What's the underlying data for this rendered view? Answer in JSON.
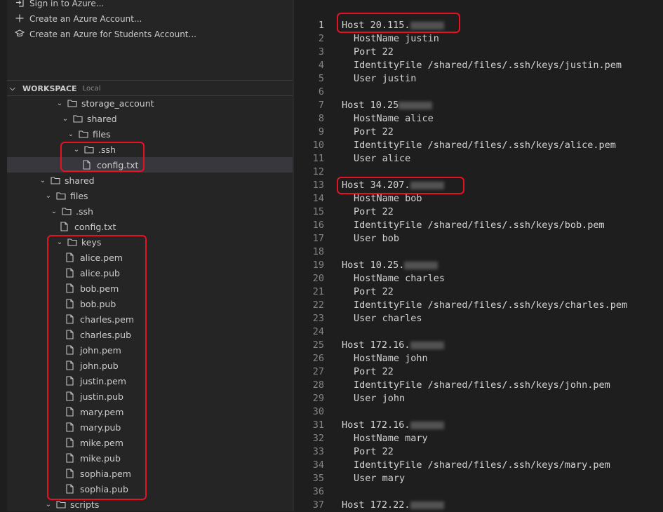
{
  "azure_actions": [
    {
      "label": "Sign in to Azure...",
      "icon": "sign-in-icon"
    },
    {
      "label": "Create an Azure Account...",
      "icon": "plus-icon"
    },
    {
      "label": "Create an Azure for Students Account...",
      "icon": "mortarboard-icon"
    }
  ],
  "workspace": {
    "title": "WORKSPACE",
    "subtitle": "Local"
  },
  "tree": [
    {
      "label": "storage_account",
      "type": "folder"
    },
    {
      "label": "shared",
      "type": "folder"
    },
    {
      "label": "files",
      "type": "folder"
    },
    {
      "label": ".ssh",
      "type": "folder"
    },
    {
      "label": "config.txt",
      "type": "file"
    },
    {
      "label": "shared",
      "type": "folder"
    },
    {
      "label": "files",
      "type": "folder"
    },
    {
      "label": ".ssh",
      "type": "folder"
    },
    {
      "label": "config.txt",
      "type": "file"
    },
    {
      "label": "keys",
      "type": "folder"
    },
    {
      "label": "alice.pem",
      "type": "file"
    },
    {
      "label": "alice.pub",
      "type": "file"
    },
    {
      "label": "bob.pem",
      "type": "file"
    },
    {
      "label": "bob.pub",
      "type": "file"
    },
    {
      "label": "charles.pem",
      "type": "file"
    },
    {
      "label": "charles.pub",
      "type": "file"
    },
    {
      "label": "john.pem",
      "type": "file"
    },
    {
      "label": "john.pub",
      "type": "file"
    },
    {
      "label": "justin.pem",
      "type": "file"
    },
    {
      "label": "justin.pub",
      "type": "file"
    },
    {
      "label": "mary.pem",
      "type": "file"
    },
    {
      "label": "mary.pub",
      "type": "file"
    },
    {
      "label": "mike.pem",
      "type": "file"
    },
    {
      "label": "mike.pub",
      "type": "file"
    },
    {
      "label": "sophia.pem",
      "type": "file"
    },
    {
      "label": "sophia.pub",
      "type": "file"
    },
    {
      "label": "scripts",
      "type": "folder"
    }
  ],
  "editor": {
    "current_line": 1,
    "lines": [
      {
        "n": "1",
        "text": "Host 20.115.",
        "redacted": true
      },
      {
        "n": "2",
        "text": "HostName justin"
      },
      {
        "n": "3",
        "text": "Port 22"
      },
      {
        "n": "4",
        "text": "IdentityFile /shared/files/.ssh/keys/justin.pem"
      },
      {
        "n": "5",
        "text": "User justin"
      },
      {
        "n": "6",
        "text": ""
      },
      {
        "n": "7",
        "text": "Host 10.25",
        "redacted": true
      },
      {
        "n": "8",
        "text": "HostName alice"
      },
      {
        "n": "9",
        "text": "Port 22"
      },
      {
        "n": "10",
        "text": "IdentityFile /shared/files/.ssh/keys/alice.pem"
      },
      {
        "n": "11",
        "text": "User alice"
      },
      {
        "n": "12",
        "text": ""
      },
      {
        "n": "13",
        "text": "Host 34.207.",
        "redacted": true
      },
      {
        "n": "14",
        "text": "HostName bob"
      },
      {
        "n": "15",
        "text": "Port 22"
      },
      {
        "n": "16",
        "text": "IdentityFile /shared/files/.ssh/keys/bob.pem"
      },
      {
        "n": "17",
        "text": "User bob"
      },
      {
        "n": "18",
        "text": ""
      },
      {
        "n": "19",
        "text": "Host 10.25.",
        "redacted": true
      },
      {
        "n": "20",
        "text": "HostName charles"
      },
      {
        "n": "21",
        "text": "Port 22"
      },
      {
        "n": "22",
        "text": "IdentityFile /shared/files/.ssh/keys/charles.pem"
      },
      {
        "n": "23",
        "text": "User charles"
      },
      {
        "n": "24",
        "text": ""
      },
      {
        "n": "25",
        "text": "Host 172.16.",
        "redacted": true
      },
      {
        "n": "26",
        "text": "HostName john"
      },
      {
        "n": "27",
        "text": "Port 22"
      },
      {
        "n": "28",
        "text": "IdentityFile /shared/files/.ssh/keys/john.pem"
      },
      {
        "n": "29",
        "text": "User john"
      },
      {
        "n": "30",
        "text": ""
      },
      {
        "n": "31",
        "text": "Host 172.16.",
        "redacted": true
      },
      {
        "n": "32",
        "text": "HostName mary"
      },
      {
        "n": "33",
        "text": "Port 22"
      },
      {
        "n": "34",
        "text": "IdentityFile /shared/files/.ssh/keys/mary.pem"
      },
      {
        "n": "35",
        "text": "User mary"
      },
      {
        "n": "36",
        "text": ""
      },
      {
        "n": "37",
        "text": "Host 172.22.",
        "redacted": true
      }
    ]
  }
}
